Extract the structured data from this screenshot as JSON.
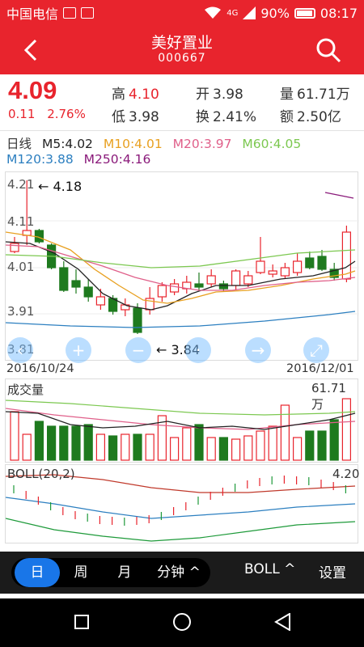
{
  "status_bar": {
    "carrier": "中国电信",
    "network": "4G",
    "battery": "90%",
    "time": "08:17"
  },
  "header": {
    "title": "美好置业",
    "code": "000667",
    "back_icon": "chevron-left-icon",
    "search_icon": "search-icon"
  },
  "quote": {
    "price": "4.09",
    "change": "0.11",
    "change_pct": "2.76%",
    "high_label": "高",
    "high": "4.10",
    "low_label": "低",
    "low": "3.98",
    "open_label": "开",
    "open": "3.98",
    "turnover_label": "换",
    "turnover": "2.41%",
    "volume_label": "量",
    "volume": "61.71万",
    "amount_label": "额",
    "amount": "2.50亿"
  },
  "ma": {
    "period": "日线",
    "m5": "M5:4.02",
    "m10": "M10:4.01",
    "m20": "M20:3.97",
    "m60": "M60:4.05",
    "m120": "M120:3.88",
    "m250": "M250:4.16",
    "colors": {
      "m5": "#222222",
      "m10": "#e8a020",
      "m20": "#e0608a",
      "m60": "#7cc850",
      "m120": "#2c7fc0",
      "m250": "#8a1a7a"
    }
  },
  "kline": {
    "y_labels": [
      "4.21",
      "4.11",
      "4.01",
      "3.91",
      "3.81"
    ],
    "max_marker": "4.18",
    "min_marker": "3.84",
    "start_date": "2016/10/24",
    "end_date": "2016/12/01",
    "zoom_buttons": [
      "zoom-in-icon",
      "zoom-out-icon",
      "arrow-right-icon",
      "fullscreen-icon"
    ]
  },
  "volume": {
    "title": "成交量",
    "max": "61.71万"
  },
  "boll": {
    "title": "BOLL(20,2)",
    "max": "4.20"
  },
  "tabs": {
    "items": [
      "日",
      "周",
      "月",
      "分钟"
    ],
    "active": "日",
    "indicator": "BOLL",
    "settings": "设置"
  },
  "nav": {
    "icons": [
      "square-icon",
      "circle-icon",
      "triangle-back-icon"
    ]
  }
}
